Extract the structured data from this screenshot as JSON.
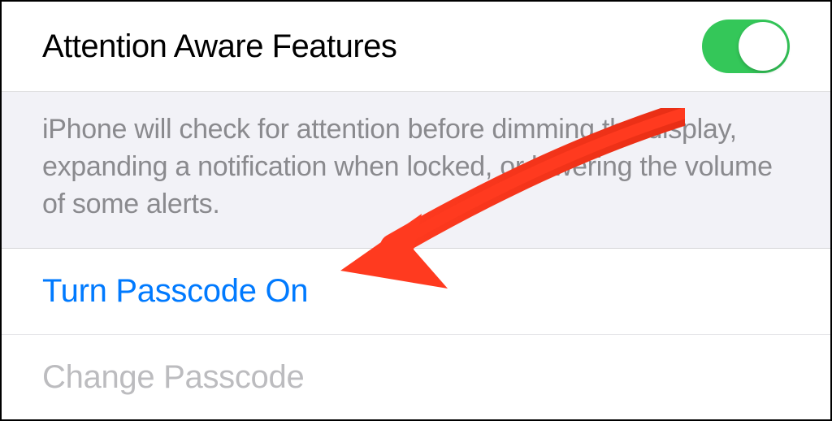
{
  "settings": {
    "attention_aware": {
      "label": "Attention Aware Features",
      "enabled": true,
      "description": "iPhone will check for attention before dimming the display, expanding a notification when locked, or lowering the volume of some alerts."
    },
    "passcode": {
      "turn_on_label": "Turn Passcode On",
      "change_label": "Change Passcode"
    }
  },
  "colors": {
    "toggle_on": "#34c759",
    "link": "#007aff",
    "disabled_text": "#bcbcbf",
    "description_text": "#8a8a8e",
    "section_bg": "#f2f2f7",
    "annotation_arrow": "#ff3a1f"
  }
}
